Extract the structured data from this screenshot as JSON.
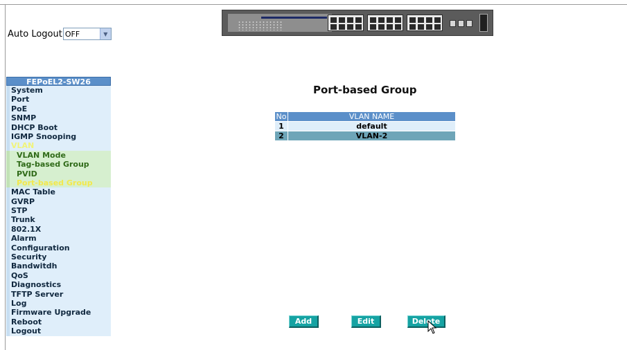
{
  "auto_logout": {
    "label": "Auto Logout",
    "value": "OFF"
  },
  "sidebar": {
    "title": "FEPoEL2-SW26",
    "items": [
      {
        "label": "System"
      },
      {
        "label": "Port"
      },
      {
        "label": "PoE"
      },
      {
        "label": "SNMP"
      },
      {
        "label": "DHCP Boot"
      },
      {
        "label": "IGMP Snooping"
      },
      {
        "label": "VLAN"
      },
      {
        "label": "VLAN Mode"
      },
      {
        "label": "Tag-based Group"
      },
      {
        "label": "PVID"
      },
      {
        "label": "Port-based Group"
      },
      {
        "label": "MAC Table"
      },
      {
        "label": "GVRP"
      },
      {
        "label": "STP"
      },
      {
        "label": "Trunk"
      },
      {
        "label": "802.1X"
      },
      {
        "label": "Alarm"
      },
      {
        "label": "Configuration"
      },
      {
        "label": "Security"
      },
      {
        "label": "Bandwitdh"
      },
      {
        "label": "QoS"
      },
      {
        "label": "Diagnostics"
      },
      {
        "label": "TFTP Server"
      },
      {
        "label": "Log"
      },
      {
        "label": "Firmware Upgrade"
      },
      {
        "label": "Reboot"
      },
      {
        "label": "Logout"
      }
    ]
  },
  "main": {
    "title": "Port-based Group",
    "table": {
      "headers": [
        "No",
        "VLAN NAME"
      ],
      "rows": [
        {
          "no": "1",
          "name": "default"
        },
        {
          "no": "2",
          "name": "VLAN-2"
        }
      ]
    },
    "buttons": {
      "add": "Add",
      "edit": "Edit",
      "delete": "Delete"
    }
  },
  "colors": {
    "sidebar_header": "#5b8fc9",
    "sidebar_item_bg": "#dfeefa",
    "submenu_bg": "#d6efcf",
    "active_text": "#f1f47a",
    "button_bg": "#16a3a3",
    "selected_row": "#6ea5b8"
  },
  "icons": [
    "dropdown-arrow-icon",
    "mouse-cursor-icon",
    "switch-panel-image"
  ]
}
